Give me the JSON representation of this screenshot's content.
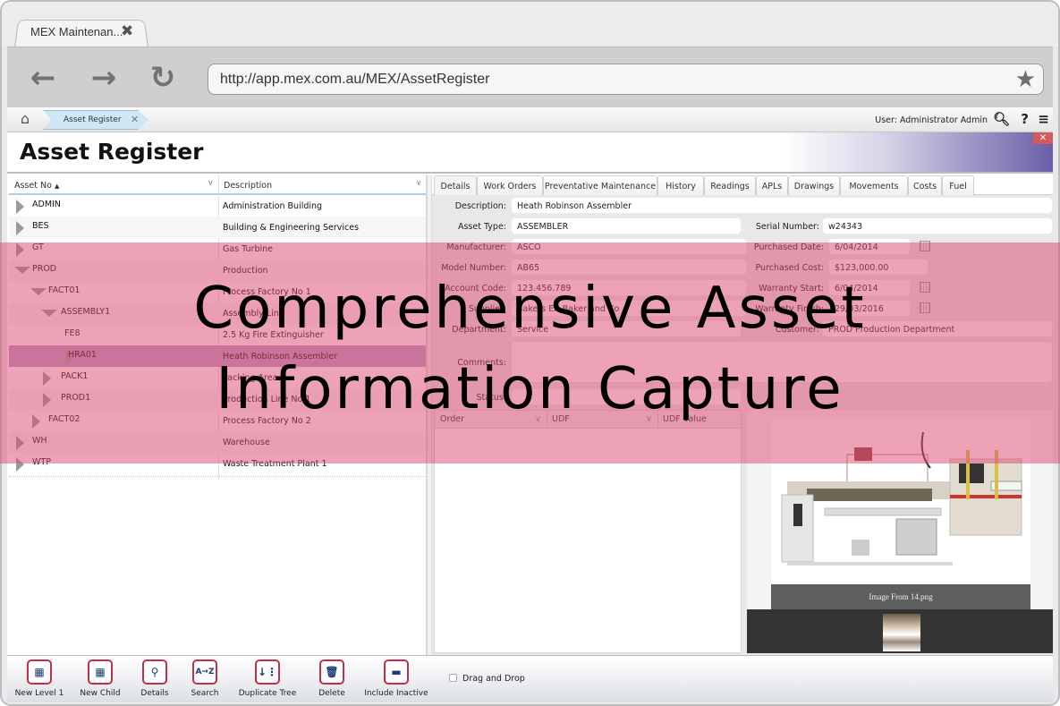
{
  "browser": {
    "tab_title": "MEX Maintenan...",
    "url": "http://app.mex.com.au/MEX/AssetRegister"
  },
  "appbar": {
    "breadcrumb": "Asset Register",
    "user": "User: Administrator Admin"
  },
  "page": {
    "title": "Asset Register"
  },
  "tree": {
    "columns": [
      "Asset No",
      "Description"
    ],
    "sort_indicator": "▲",
    "rows": [
      {
        "asset_no": "ADMIN",
        "description": "Administration Building",
        "level": 0,
        "expander": "collapsed",
        "selected": false
      },
      {
        "asset_no": "BES",
        "description": "Building & Engineering Services",
        "level": 0,
        "expander": "collapsed",
        "selected": false
      },
      {
        "asset_no": "GT",
        "description": "Gas Turbine",
        "level": 0,
        "expander": "collapsed",
        "selected": false
      },
      {
        "asset_no": "PROD",
        "description": "Production",
        "level": 0,
        "expander": "expanded",
        "selected": false
      },
      {
        "asset_no": "FACT01",
        "description": "Process Factory No 1",
        "level": 1,
        "expander": "expanded",
        "selected": false
      },
      {
        "asset_no": "ASSEMBLY1",
        "description": "Assembly Line",
        "level": 2,
        "expander": "expanded",
        "selected": false
      },
      {
        "asset_no": "FE8",
        "description": "2.5 Kg Fire Extinguisher",
        "level": 3,
        "expander": "none",
        "selected": false
      },
      {
        "asset_no": "HRA01",
        "description": "Heath Robinson Assembler",
        "level": 3,
        "expander": "collapsed",
        "selected": true
      },
      {
        "asset_no": "PACK1",
        "description": "Packing Area 1",
        "level": 2,
        "expander": "collapsed",
        "selected": false
      },
      {
        "asset_no": "PROD1",
        "description": "Production Line No 1",
        "level": 2,
        "expander": "collapsed",
        "selected": false
      },
      {
        "asset_no": "FACT02",
        "description": "Process Factory No 2",
        "level": 1,
        "expander": "collapsed",
        "selected": false
      },
      {
        "asset_no": "WH",
        "description": "Warehouse",
        "level": 0,
        "expander": "collapsed",
        "selected": false
      },
      {
        "asset_no": "WTP",
        "description": "Waste Treatment Plant 1",
        "level": 0,
        "expander": "collapsed",
        "selected": false
      }
    ]
  },
  "detail": {
    "tabs": [
      "Details",
      "Work Orders",
      "Preventative Maintenance",
      "History",
      "Readings",
      "APLs",
      "Drawings",
      "Movements",
      "Costs",
      "Fuel"
    ],
    "active_tab": "Details",
    "fields": {
      "description": {
        "label": "Description:",
        "value": "Heath Robinson Assembler"
      },
      "asset_type": {
        "label": "Asset Type:",
        "value": "ASSEMBLER"
      },
      "serial_number": {
        "label": "Serial Number:",
        "value": "w24343"
      },
      "manufacturer": {
        "label": "Manufacturer:",
        "value": "ASCO"
      },
      "purchased_date": {
        "label": "Purchased Date:",
        "value": "6/04/2014"
      },
      "model_number": {
        "label": "Model Number:",
        "value": "AB65"
      },
      "purchased_cost": {
        "label": "Purchased Cost:",
        "value": "$123,000.00"
      },
      "account_code": {
        "label": "Account Code:",
        "value": "123.456.789"
      },
      "warranty_start": {
        "label": "Warranty Start:",
        "value": "6/04/2014"
      },
      "supplier": {
        "label": "Supplier:",
        "value": "Bakers EA Baker and Co"
      },
      "warranty_finish": {
        "label": "Warranty Finish:",
        "value": "29/03/2016"
      },
      "department": {
        "label": "Department:",
        "value": "Service"
      },
      "customer": {
        "label": "Customer:",
        "value": "PROD Production Department"
      },
      "comments": {
        "label": "Comments:",
        "value": ""
      },
      "status": {
        "label": "Status:",
        "value": ""
      }
    },
    "udf_grid": {
      "columns": [
        "Order",
        "UDF",
        "UDF Value"
      ]
    },
    "gallery": {
      "caption": "Image From 14.png"
    }
  },
  "bottom_toolbar": {
    "buttons": [
      {
        "label": "New Level 1",
        "icon": "new-level-icon",
        "glyph": "▦"
      },
      {
        "label": "New Child",
        "icon": "new-child-icon",
        "glyph": "▦"
      },
      {
        "label": "Details",
        "icon": "magnifier-icon",
        "glyph": "⚲"
      },
      {
        "label": "Search",
        "icon": "sort-az-icon",
        "glyph": "A→Z"
      },
      {
        "label": "Duplicate Tree",
        "icon": "duplicate-tree-icon",
        "glyph": "↓⋮"
      },
      {
        "label": "Delete",
        "icon": "trash-icon",
        "glyph": "🗑"
      },
      {
        "label": "Include Inactive",
        "icon": "include-inactive-icon",
        "glyph": "▬"
      }
    ],
    "drag_and_drop": {
      "label": "Drag and Drop",
      "checked": false
    }
  },
  "overlay": {
    "line1": "Comprehensive Asset",
    "line2": "Information Capture",
    "color": "#de466e"
  }
}
